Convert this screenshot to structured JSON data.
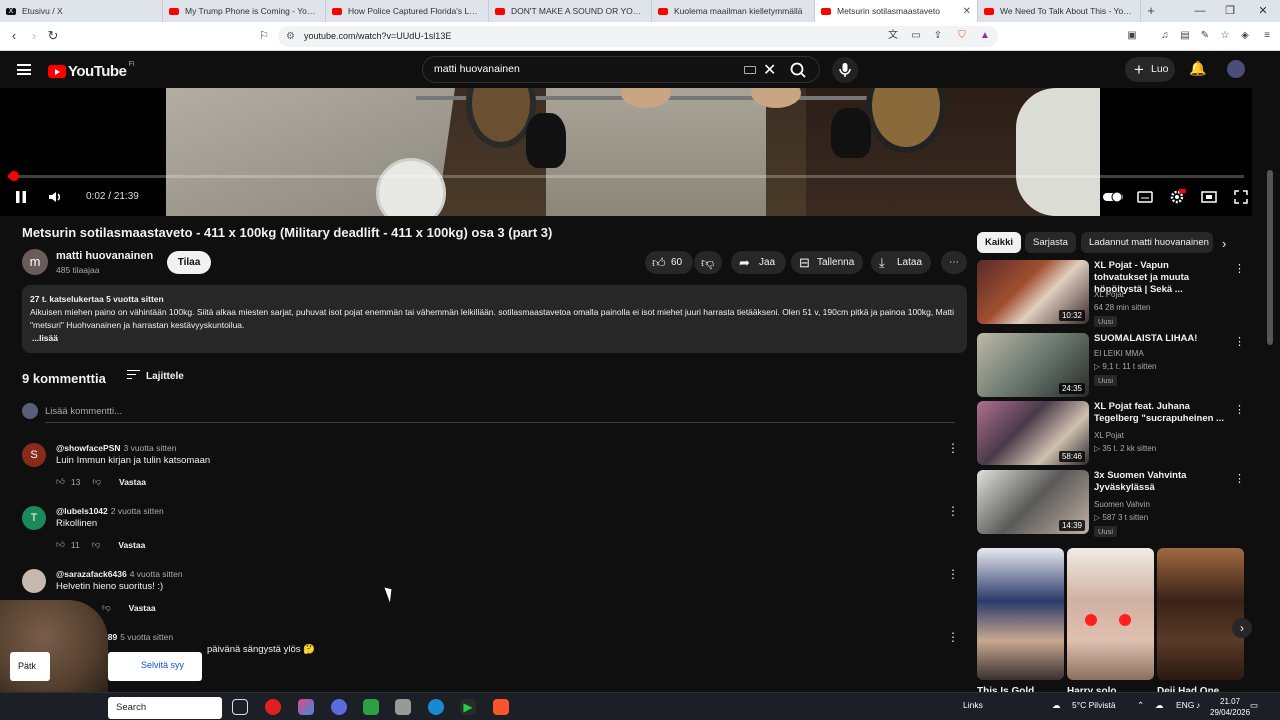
{
  "browser": {
    "tabs": [
      {
        "label": "Etusivu / X",
        "icon": "x-logo",
        "active": false
      },
      {
        "label": "My Trump Phone is Coming - YouTube",
        "icon": "youtube",
        "active": false
      },
      {
        "label": "How Police Captured Florida's Longs",
        "icon": "youtube",
        "active": false
      },
      {
        "label": "DON'T MAKE A SOUND OR YOU DIE",
        "icon": "youtube",
        "active": false
      },
      {
        "label": "Kuolema maailman kielletymmällä",
        "icon": "youtube",
        "active": false
      },
      {
        "label": "Metsurin sotilasmaastaveto",
        "icon": "youtube",
        "active": true
      },
      {
        "label": "We Need To Talk About This - YouTube",
        "icon": "youtube",
        "active": false
      }
    ],
    "url": "youtube.com/watch?v=UUdU-1sl13E"
  },
  "youtube": {
    "logo_text": "YouTube",
    "region": "FI",
    "search_value": "matti huovanainen",
    "create_label": "Luo"
  },
  "player": {
    "time_current": "0:02",
    "time_total": "21:39",
    "progress_fraction": 0.002
  },
  "video": {
    "title": "Metsurin sotilasmaastaveto - 411 x 100kg (Military deadlift - 411 x 100kg) osa 3 (part 3)",
    "channel": "matti huovanainen",
    "channel_initial": "m",
    "subscribers": "485 tilaajaa",
    "subscribe_label": "Tilaa",
    "likes": "60",
    "share_label": "Jaa",
    "save_label": "Tallenna",
    "download_label": "Lataa"
  },
  "description": {
    "meta": "27 t. katselukertaa  5 vuotta sitten",
    "body": "Aikuisen miehen paino on vähintään 100kg. Siitä alkaa miesten sarjat, puhuvat isot pojat enemmän tai vähemmän leikillään. sotilasmaastavetoa omalla painolla ei isot miehet juuri harrasta tietääkseni. Olen 51 v, 190cm pitkä ja painoa 100kg, Matti \"metsuri\" Huohvanainen ja harrastan kestävyyskuntoilua.",
    "more": "...lisää"
  },
  "comments": {
    "count_label": "9 kommenttia",
    "sort_label": "Lajittele",
    "add_placeholder": "Lisää kommentti...",
    "reply_label": "Vastaa",
    "items": [
      {
        "user": "@showfacePSN",
        "age": "3 vuotta sitten",
        "text": "Luin Immun kirjan ja tulin katsomaan",
        "likes": "13",
        "avatar_color": "#8a2a1a",
        "initial": "S"
      },
      {
        "user": "@lubels1042",
        "age": "2 vuotta sitten",
        "text": "Rikollinen",
        "likes": "11",
        "avatar_color": "#1a8a5a",
        "initial": "T"
      },
      {
        "user": "@sarazafack6436",
        "age": "4 vuotta sitten",
        "text": "Helvetin hieno suoritus! :)",
        "likes": "",
        "avatar_color": "#c8b9b0",
        "initial": ""
      },
      {
        "user": "289",
        "age": "5 vuotta sitten",
        "text": "päivänä sängystä ylös 🤔",
        "likes": "",
        "avatar_color": "#444",
        "initial": ""
      }
    ]
  },
  "sidebar": {
    "chips": [
      {
        "label": "Kaikki",
        "active": true
      },
      {
        "label": "Sarjasta",
        "active": false
      },
      {
        "label": "Ladannut matti huovanainen",
        "active": false
      }
    ],
    "recs": [
      {
        "title": "XL Pojat - Vapun tohvatukset ja muuta höpöitystä | Sekä ...",
        "channel": "XL Pojat",
        "meta": "64  28 min sitten",
        "badge": "Uusi",
        "duration": "10:32"
      },
      {
        "title": "SUOMALAISTA LIHAA!",
        "channel": "El LEIKI MMA",
        "meta": "▷ 9,1 t.  11 t sitten",
        "badge": "Uusi",
        "duration": "24:35"
      },
      {
        "title": "XL Pojat feat. Juhana Tegelberg \"sucrapuheinen ...",
        "channel": "XL Pojat",
        "meta": "▷ 35 t.  2 kk sitten",
        "badge": "",
        "duration": "58:46"
      },
      {
        "title": "3x Suomen Vahvinta Jyväskylässä",
        "channel": "Suomen Vahvin",
        "meta": "▷ 587  3 t sitten",
        "badge": "Uusi",
        "duration": "14:39"
      }
    ],
    "shorts": [
      {
        "title": "This Is Gold"
      },
      {
        "title": "Harry solo"
      },
      {
        "title": "Deji Had One"
      }
    ]
  },
  "overlay": {
    "card_label": "Pätk",
    "popup_label": "Selvitä syy"
  },
  "taskbar": {
    "search_label": "Search",
    "links_label": "Links",
    "weather": "5°C  Pilvistä",
    "lang": "ENG",
    "time": "21.07",
    "date": "29/04/2026"
  }
}
